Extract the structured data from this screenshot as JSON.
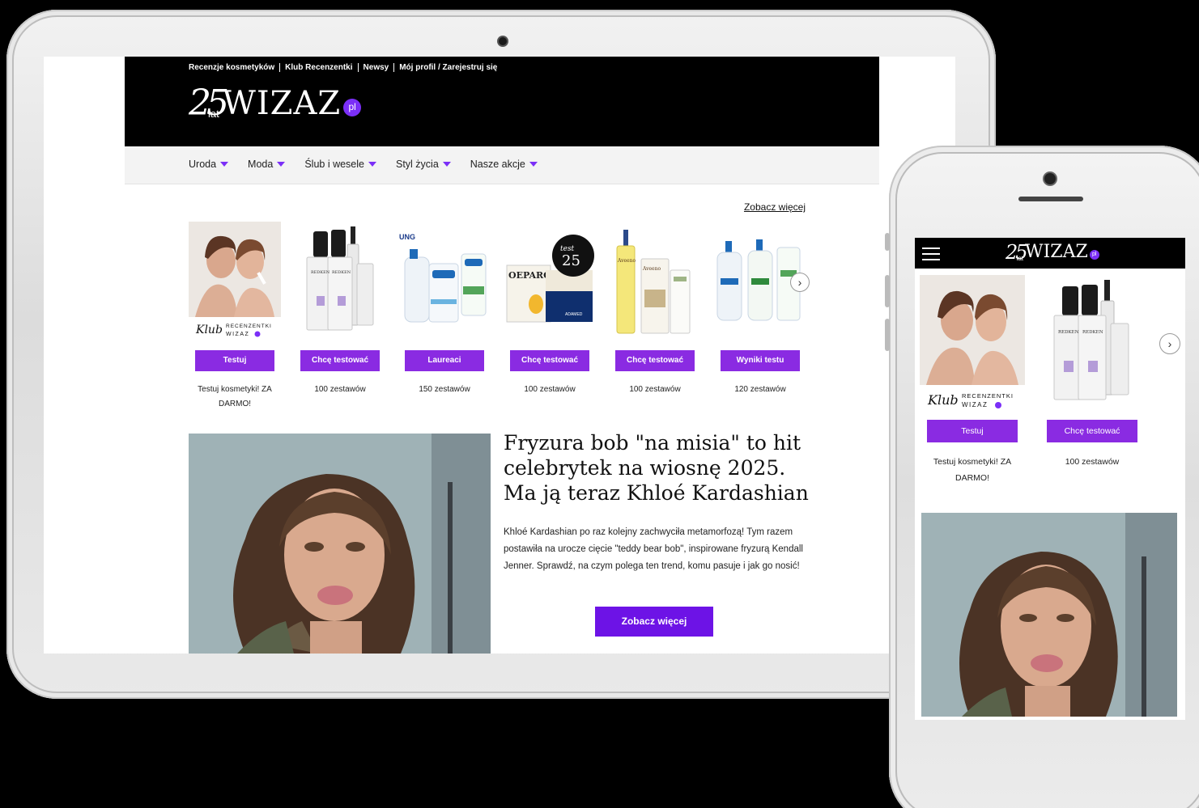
{
  "tablet": {
    "top_links": [
      "Recenzje kosmetyków",
      "Klub Recenzentki",
      "Newsy",
      "Mój profil / Zarejestruj się"
    ],
    "logo": {
      "number": "25",
      "lat": "lat",
      "word": "WIZAZ",
      "tld": "pl"
    },
    "nav": [
      "Uroda",
      "Moda",
      "Ślub i wesele",
      "Styl życia",
      "Nasze akcje"
    ],
    "see_more_link": "Zobacz więcej",
    "products": [
      {
        "button": "Testuj",
        "caption": "Testuj kosmetyki! ZA DARMO!",
        "brand_text": "Klub RECENZENTKI WIZAZ"
      },
      {
        "button": "Chcę testować",
        "caption": "100 zestawów",
        "brand_text": "REDKEN"
      },
      {
        "button": "Laureaci",
        "caption": "150 zestawów",
        "brand_text": "Cetaphil"
      },
      {
        "button": "Chcę testować",
        "caption": "100 zestawów",
        "brand_text": "OEPAROL"
      },
      {
        "button": "Chcę testować",
        "caption": "100 zestawów",
        "brand_text": "Aveeno"
      },
      {
        "button": "Wyniki testu",
        "caption": "120 zestawów",
        "brand_text": "Cetaphil"
      }
    ],
    "article": {
      "title": "Fryzura bob \"na misia\" to hit celebrytek na wiosnę 2025. Ma ją teraz Khloé Kardashian",
      "text": "Khloé Kardashian po raz kolejny zachwyciła metamorfozą! Tym razem postawiła na urocze cięcie \"teddy bear bob\", inspirowane fryzurą Kendall Jenner. Sprawdź, na czym polega ten trend, komu pasuje i jak go nosić!",
      "button": "Zobacz więcej"
    },
    "colors": {
      "accent": "#8a2be2",
      "cta": "#6d13e6",
      "header_bg": "#000000"
    },
    "icons": {
      "next_arrow": "chevron-right-icon",
      "nav_caret": "caret-down-icon"
    }
  },
  "phone": {
    "logo": {
      "number": "25",
      "lat": "lat",
      "word": "WIZAZ",
      "tld": "pl"
    },
    "products": [
      {
        "button": "Testuj",
        "caption": "Testuj kosmetyki! ZA DARMO!",
        "brand_text": "Klub RECENZENTKI WIZAZ"
      },
      {
        "button": "Chcę testować",
        "caption": "100 zestawów",
        "brand_text": "REDKEN"
      }
    ],
    "icons": {
      "menu": "hamburger-icon",
      "next_arrow": "chevron-right-icon"
    }
  }
}
